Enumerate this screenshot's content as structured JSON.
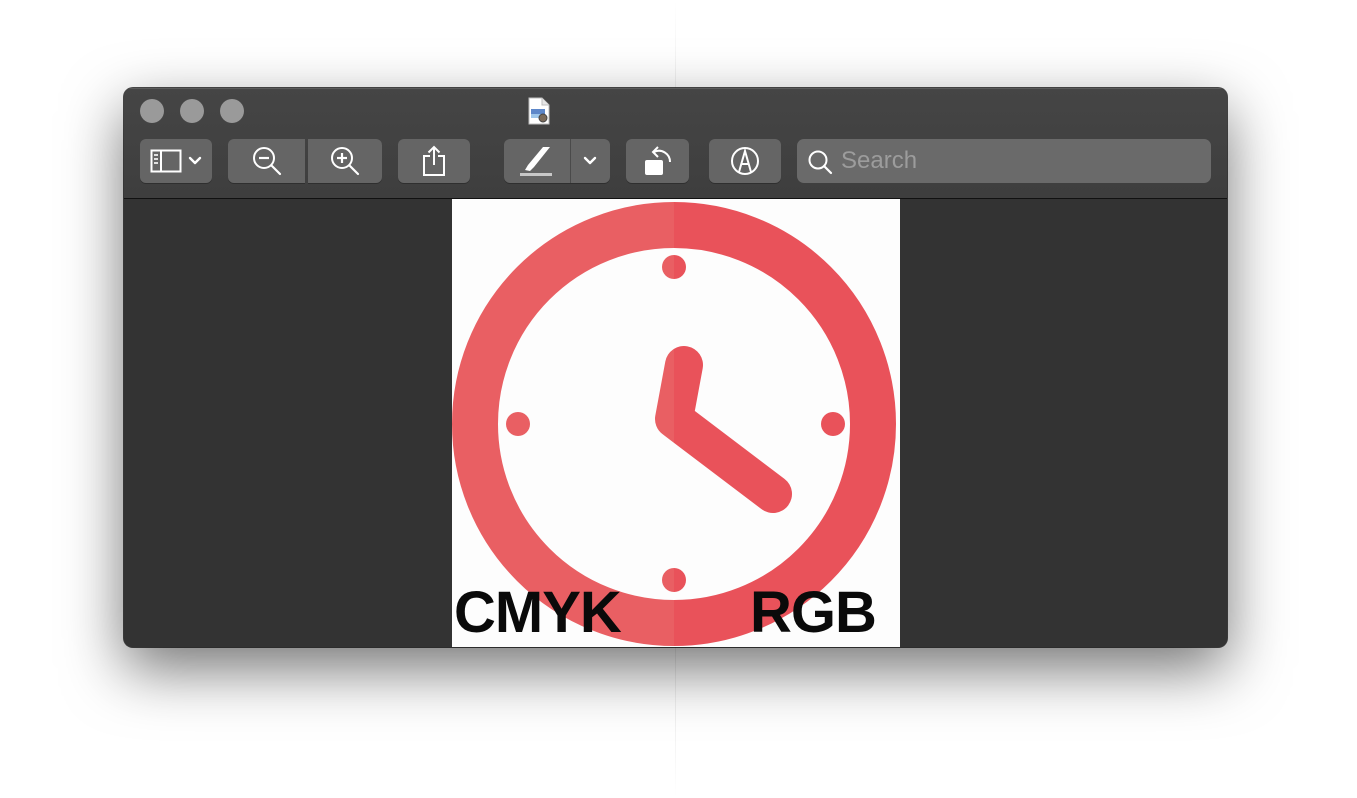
{
  "window": {
    "title_icon": "preview-document-icon",
    "traffic_lights": [
      "close",
      "minimize",
      "zoom"
    ]
  },
  "toolbar": {
    "buttons": [
      {
        "name": "sidebar-toggle",
        "icon": "sidebar-icon",
        "has_dropdown": true
      },
      {
        "name": "zoom-out",
        "icon": "zoom-out-icon"
      },
      {
        "name": "zoom-in",
        "icon": "zoom-in-icon"
      },
      {
        "name": "share",
        "icon": "share-icon"
      },
      {
        "name": "highlight",
        "icon": "highlighter-icon",
        "has_dropdown": true
      },
      {
        "name": "rotate",
        "icon": "rotate-left-icon"
      },
      {
        "name": "markup",
        "icon": "markup-pen-icon"
      }
    ],
    "search": {
      "placeholder": "Search",
      "value": ""
    }
  },
  "document": {
    "image": "clock-icon",
    "labels": {
      "left": "CMYK",
      "right": "RGB"
    },
    "colors": {
      "cmyk_red": "#e95f63",
      "rgb_red": "#e9525a"
    }
  }
}
